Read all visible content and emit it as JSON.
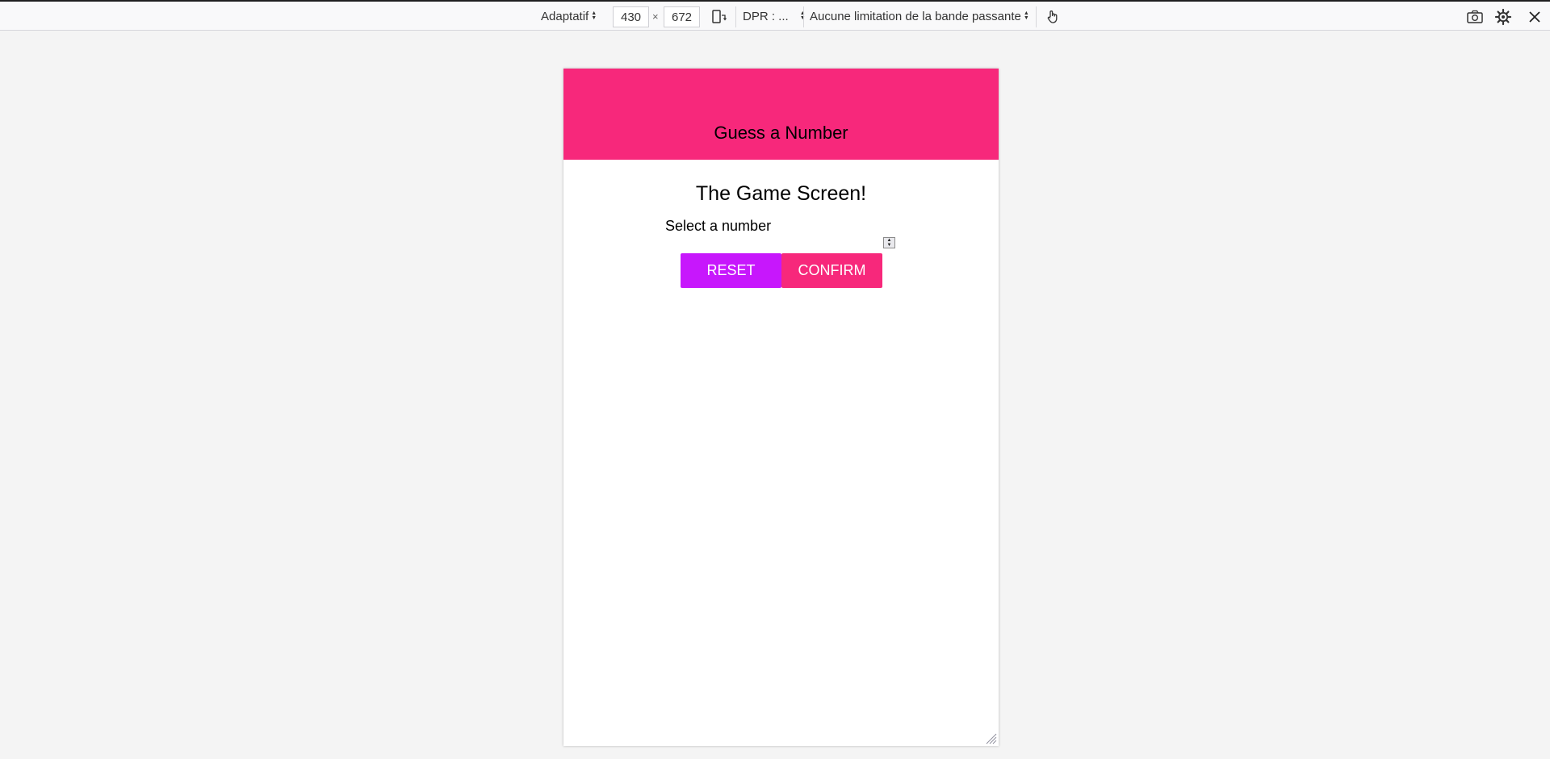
{
  "devtools": {
    "device_mode": "Adaptatif",
    "width": "430",
    "times": "×",
    "height": "672",
    "dpr": "DPR : ...",
    "throttling": "Aucune limitation de la bande passante"
  },
  "app": {
    "header_title": "Guess a Number",
    "screen_title": "The Game Screen!",
    "select_label": "Select a number",
    "reset_label": "RESET",
    "confirm_label": "CONFIRM"
  },
  "colors": {
    "primary": "#f7287b",
    "accent": "#c717fc"
  },
  "icons": [
    "rotate-device-icon",
    "touch-simulation-icon",
    "screenshot-icon",
    "settings-icon",
    "close-icon",
    "resize-handle-icon"
  ]
}
